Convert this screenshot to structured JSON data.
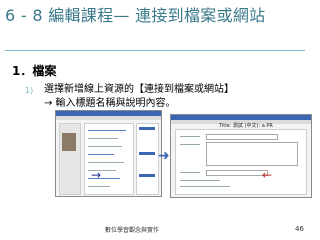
{
  "slide": {
    "title": "6 - 8  編輯課程— 連接到檔案或網站",
    "heading": "1．檔案",
    "bullet_number": "1)",
    "bullet_line1": "選擇新增線上資源的【連接到檔案或網站】",
    "bullet_line2": "→ 輸入標題名稱與說明內容。"
  },
  "screenshot_b": {
    "popup_title": "Title: 測試 (中文): a.PR"
  },
  "footer": {
    "center": "數位學習觀念與實作",
    "page_number": "46"
  },
  "colors": {
    "title": "#3a7a8a",
    "rule": "#7fb8c8",
    "window_bar": "#3b66b5"
  }
}
